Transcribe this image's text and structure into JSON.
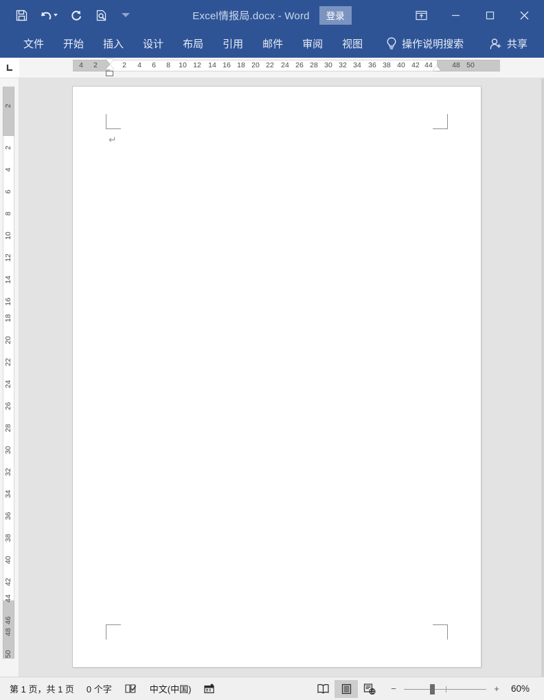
{
  "titlebar": {
    "quick_access": [
      {
        "name": "save-button",
        "icon": "save-icon",
        "label": "保存"
      },
      {
        "name": "undo-button",
        "icon": "undo-icon",
        "label": "撤消"
      },
      {
        "name": "redo-button",
        "icon": "redo-icon",
        "label": "重复"
      },
      {
        "name": "print-preview-button",
        "icon": "print-preview-icon",
        "label": "打印预览和打印"
      },
      {
        "name": "customize-qat-button",
        "icon": "chevron-down-icon",
        "label": "自定义快速访问工具栏"
      }
    ],
    "doc_title": "Excel情报局.docx  -  Word",
    "signin_label": "登录",
    "window_buttons": [
      {
        "name": "ribbon-display-options-button",
        "icon": "ribbon-display-icon",
        "label": "功能区显示选项"
      },
      {
        "name": "minimize-button",
        "icon": "minimize-icon",
        "label": "最小化"
      },
      {
        "name": "maximize-button",
        "icon": "maximize-icon",
        "label": "最大化"
      },
      {
        "name": "close-button",
        "icon": "close-icon",
        "label": "关闭"
      }
    ]
  },
  "ribbon": {
    "tabs": [
      {
        "label": "文件"
      },
      {
        "label": "开始"
      },
      {
        "label": "插入"
      },
      {
        "label": "设计"
      },
      {
        "label": "布局"
      },
      {
        "label": "引用"
      },
      {
        "label": "邮件"
      },
      {
        "label": "审阅"
      },
      {
        "label": "视图"
      }
    ],
    "tellme_label": "操作说明搜索",
    "share_label": "共享"
  },
  "ruler": {
    "tab_selector_label": "左对齐式制表符",
    "horizontal_numbers": [
      "4",
      "2",
      "2",
      "4",
      "6",
      "8",
      "10",
      "12",
      "14",
      "16",
      "18",
      "20",
      "22",
      "24",
      "26",
      "28",
      "30",
      "32",
      "34",
      "36",
      "38",
      "40",
      "42",
      "44",
      "48",
      "50"
    ],
    "vertical_numbers": [
      "2",
      "2",
      "4",
      "6",
      "8",
      "10",
      "12",
      "14",
      "16",
      "18",
      "20",
      "22",
      "24",
      "26",
      "28",
      "30",
      "32",
      "34",
      "36",
      "38",
      "40",
      "42",
      "44",
      "46",
      "48",
      "50"
    ]
  },
  "document": {
    "paragraph_mark": "↵"
  },
  "statusbar": {
    "page_info": "第 1 页，共 1 页",
    "word_count": "0 个字",
    "proofing_icon_label": "校对",
    "language": "中文(中国)",
    "macro_icon_label": "宏录制",
    "views": [
      {
        "name": "read-mode-button",
        "icon": "read-mode-icon",
        "label": "阅读视图",
        "active": false
      },
      {
        "name": "print-layout-button",
        "icon": "print-layout-icon",
        "label": "页面视图",
        "active": true
      },
      {
        "name": "web-layout-button",
        "icon": "web-layout-icon",
        "label": "Web 版式视图",
        "active": false
      }
    ],
    "zoom_out_label": "−",
    "zoom_in_label": "+",
    "zoom_level": "60%"
  },
  "colors": {
    "titlebar": "#2e5496",
    "ribbon": "#2e5496",
    "signin_bg": "#7b93c0",
    "canvas": "#e3e3e3",
    "page": "#ffffff",
    "statusbar": "#f0f0f0",
    "ruler_margin": "#c8c8c8"
  }
}
